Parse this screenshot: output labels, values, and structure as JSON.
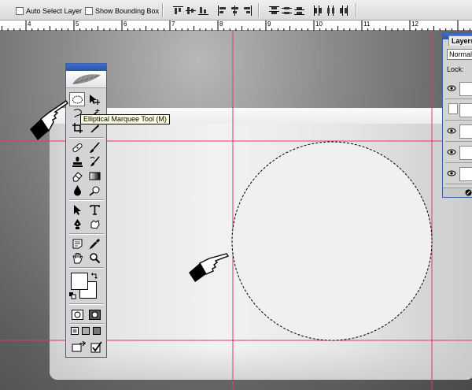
{
  "options_bar": {
    "auto_select_label": "Auto Select Layer",
    "show_bounding_label": "Show Bounding Box"
  },
  "ruler": {
    "labels": [
      "4",
      "5",
      "6",
      "7",
      "8",
      "9",
      "10",
      "11",
      "12"
    ]
  },
  "toolbox": {
    "active_tool": "elliptical-marquee",
    "tooltip": "Elliptical Marquee Tool (M)"
  },
  "layers_panel": {
    "tab_label": "Layers",
    "blend_mode": "Normal",
    "lock_label": "Lock:"
  },
  "colors": {
    "guide": "#e8336b",
    "toolbox_border": "#3b5fae",
    "tooltip_bg": "#ffffe1"
  }
}
